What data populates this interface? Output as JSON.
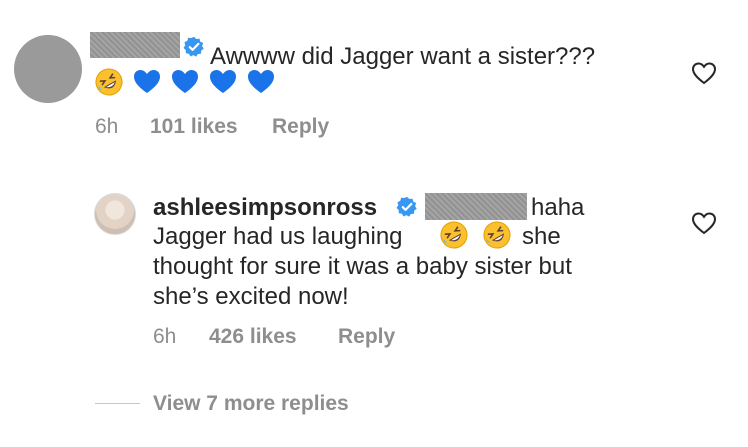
{
  "comment1": {
    "text": "Awwww did Jagger want a sister???",
    "emojis": [
      "rofl-emoji",
      "blue-heart-emoji",
      "blue-heart-emoji",
      "blue-heart-emoji",
      "blue-heart-emoji"
    ],
    "time": "6h",
    "likes": "101 likes",
    "reply": "Reply"
  },
  "reply1": {
    "username": "ashleesimpsonross",
    "text_first": "haha",
    "line2_a": "Jagger had us laughing",
    "line2_b": "she",
    "line3": "thought for sure it was a baby sister but",
    "line4": "she’s excited now!",
    "time": "6h",
    "likes": "426 likes",
    "reply": "Reply"
  },
  "view_more": "View 7 more replies",
  "colors": {
    "text": "#262626",
    "meta": "#8e8e8e",
    "verified": "#3897f0",
    "heart_blue": "#1a73e8",
    "redaction": "#9a9a9a"
  }
}
